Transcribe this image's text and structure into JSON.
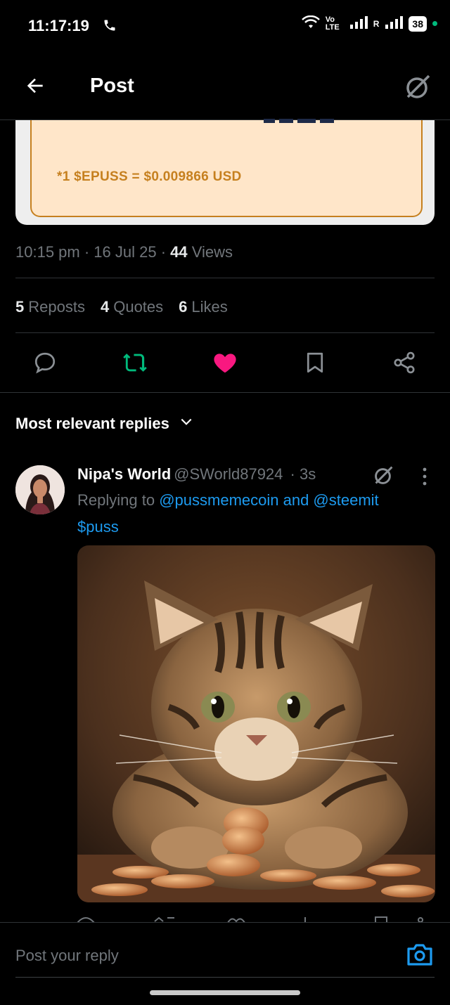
{
  "status_bar": {
    "time": "11:17:19",
    "network_label": "Vo LTE",
    "roaming": "R",
    "battery": "38"
  },
  "header": {
    "title": "Post"
  },
  "embedded_card": {
    "rate_text": "*1 $EPUSS = $0.009866 USD"
  },
  "post_meta": {
    "time": "10:15 pm",
    "date": "16 Jul 25",
    "views_count": "44",
    "views_label": "Views"
  },
  "stats": {
    "reposts_count": "5",
    "reposts_label": "Reposts",
    "quotes_count": "4",
    "quotes_label": "Quotes",
    "likes_count": "6",
    "likes_label": "Likes"
  },
  "sort": {
    "label": "Most relevant replies"
  },
  "reply": {
    "name": "Nipa's World",
    "handle": "@SWorld87924",
    "age": "· 3s",
    "replying_prefix": "Replying to",
    "replying_to": "@pussmemecoin and @steemit",
    "text": "$puss"
  },
  "compose": {
    "placeholder": "Post your reply"
  },
  "colors": {
    "accent_blue": "#1d9bf0",
    "repost_green": "#00ba7c",
    "like_pink": "#f91880",
    "card_bg": "#ffe6c9",
    "card_border": "#c6801f"
  }
}
